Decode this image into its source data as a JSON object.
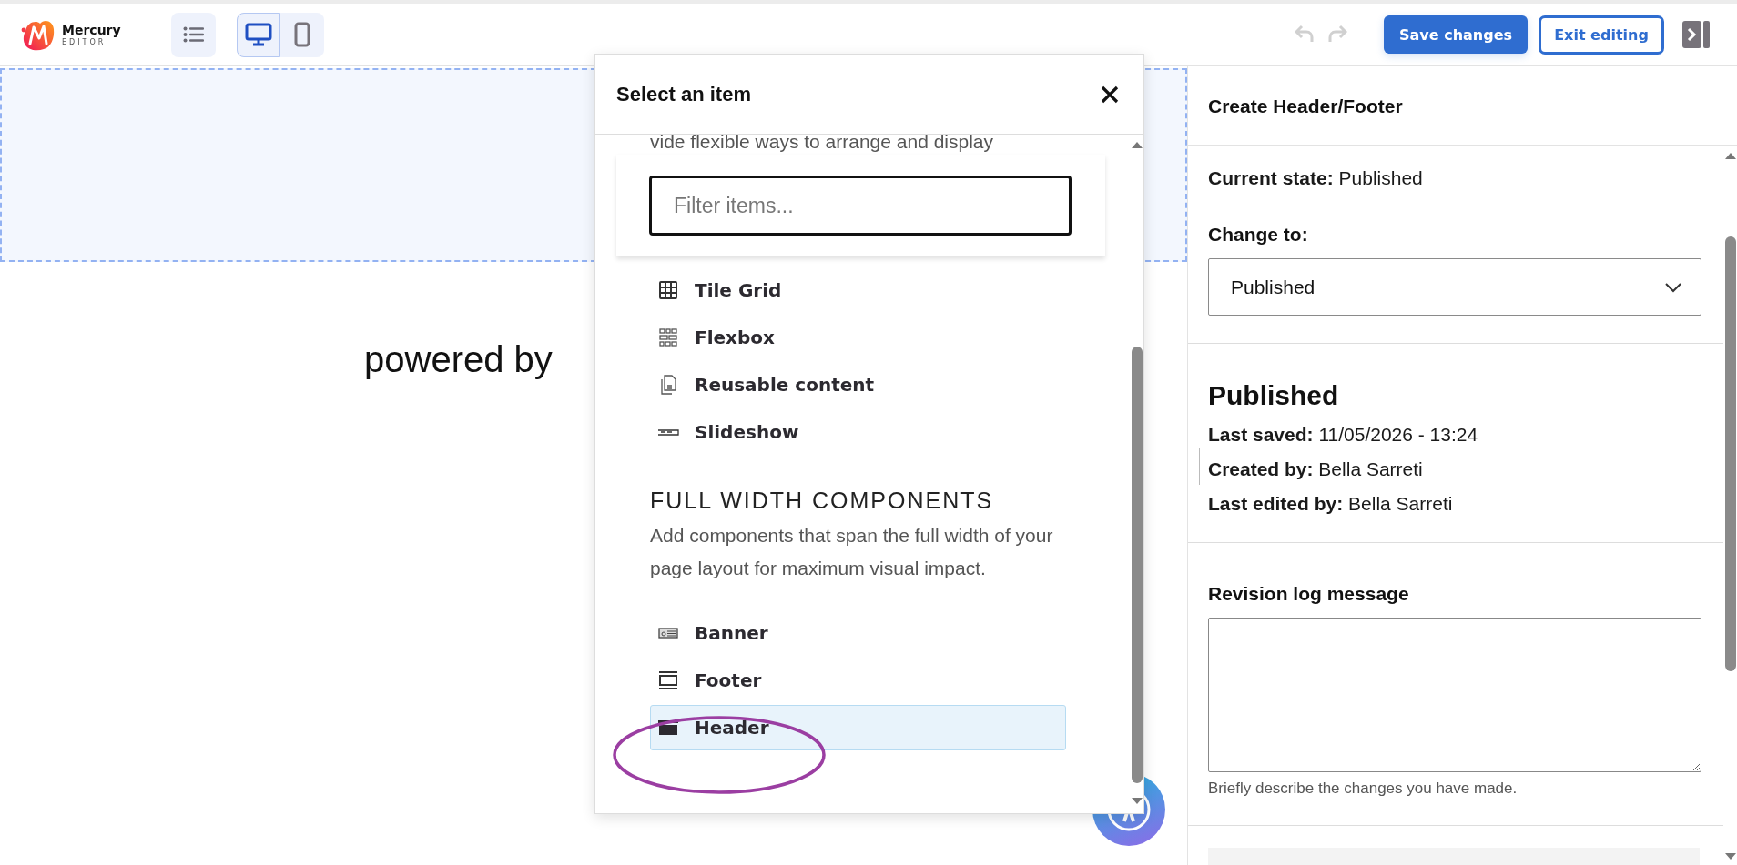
{
  "toolbar": {
    "logo": {
      "name": "Mercury",
      "tagline": "EDITOR"
    },
    "view_modes": [
      {
        "kind": "desktop",
        "selected": true
      },
      {
        "kind": "mobile",
        "selected": false
      }
    ],
    "undo": {
      "disabled": true
    },
    "redo": {
      "disabled": true
    },
    "save_button": "Save changes",
    "exit_button": "Exit editing"
  },
  "canvas": {
    "powered_by": "powered by"
  },
  "modal": {
    "title": "Select an item",
    "intro_fragment": "vide flexible ways to arrange and display",
    "filter": {
      "placeholder": "Filter items..."
    },
    "groups": [
      {
        "items": [
          {
            "label": "Tile Grid",
            "kind": "grid",
            "selected": false
          },
          {
            "label": "Flexbox",
            "kind": "flexbox",
            "selected": false
          },
          {
            "label": "Reusable content",
            "kind": "reusable",
            "selected": false
          },
          {
            "label": "Slideshow",
            "kind": "slideshow",
            "selected": false
          }
        ]
      },
      {
        "heading": "FULL WIDTH COMPONENTS",
        "description": "Add components that span the full width of your page layout for maximum visual impact.",
        "items": [
          {
            "label": "Banner",
            "kind": "banner",
            "selected": false
          },
          {
            "label": "Footer",
            "kind": "footer",
            "selected": false
          },
          {
            "label": "Header",
            "kind": "header",
            "selected": true
          }
        ]
      }
    ]
  },
  "panel": {
    "title": "Create Header/Footer",
    "current_state": {
      "label": "Current state:",
      "value": "Published"
    },
    "change_to": {
      "label": "Change to:",
      "value": "Published"
    },
    "status": {
      "heading": "Published",
      "rows": [
        {
          "label": "Last saved:",
          "value": "11/05/2026 - 13:24"
        },
        {
          "label": "Created by:",
          "value": "Bella Sarreti"
        },
        {
          "label": "Last edited by:",
          "value": "Bella Sarreti"
        }
      ]
    },
    "revision": {
      "label": "Revision log message",
      "hint": "Briefly describe the changes you have made."
    }
  }
}
